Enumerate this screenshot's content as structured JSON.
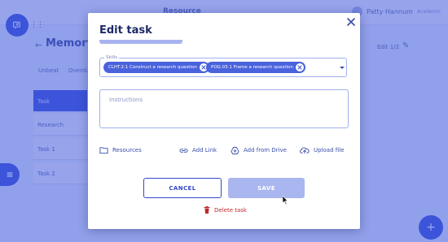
{
  "background": {
    "topbar_title": "Resource",
    "user_name": "Patty Hannum",
    "user_role": "Academic",
    "page_title": "Memory",
    "tabs": [
      "Unbeat",
      "Overdue"
    ],
    "rows": [
      "Task",
      "Research",
      "Task 1",
      "Task 2"
    ],
    "right_chip": "Edit 1/2"
  },
  "modal": {
    "title": "Edit task",
    "skills": {
      "label": "Skills",
      "chips": [
        "CLHT.2.1 Construct a research question",
        "POG.03.1 Frame a research question"
      ]
    },
    "instructions": {
      "placeholder": "Instructions",
      "value": ""
    },
    "actions": {
      "resources": "Resources",
      "add_link": "Add Link",
      "add_from_drive": "Add from Drive",
      "upload_file": "Upload file"
    },
    "cancel_label": "CANCEL",
    "save_label": "SAVE",
    "delete_label": "Delete task"
  },
  "colors": {
    "primary": "#3447c4",
    "chip": "#4a62dc",
    "save_disabled": "#a9b6ef",
    "danger": "#c0292f",
    "overlay": "#3a54de"
  },
  "icons": {
    "close": "close-icon",
    "chip_remove": "x-circle-icon",
    "dropdown": "chevron-down-icon",
    "resources": "folder-icon",
    "add_link": "link-icon",
    "add_from_drive": "drive-icon",
    "upload_file": "cloud-upload-icon",
    "delete": "trash-icon"
  }
}
